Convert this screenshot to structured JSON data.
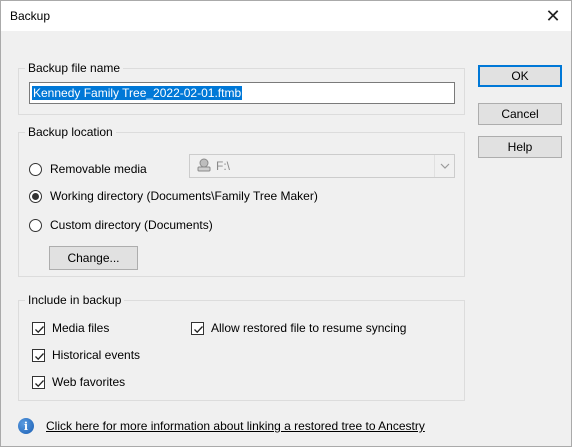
{
  "window": {
    "title": "Backup",
    "close_symbol": "✕"
  },
  "filename_group": {
    "label": "Backup file name",
    "value": "Kennedy Family Tree_2022-02-01.ftmb"
  },
  "buttons": {
    "ok": "OK",
    "cancel": "Cancel",
    "help": "Help"
  },
  "location_group": {
    "label": "Backup location",
    "options": [
      {
        "label": "Removable media",
        "selected": false
      },
      {
        "label": "Working directory (Documents\\Family Tree Maker)",
        "selected": true
      },
      {
        "label": "Custom directory (Documents)",
        "selected": false
      }
    ],
    "drive_value": "F:\\",
    "change_label": "Change..."
  },
  "include_group": {
    "label": "Include in backup",
    "items": [
      {
        "label": "Media files",
        "checked": true
      },
      {
        "label": "Historical events",
        "checked": true
      },
      {
        "label": "Web favorites",
        "checked": true
      },
      {
        "label": "Allow restored file to resume syncing",
        "checked": true
      }
    ]
  },
  "info": {
    "icon": "info-icon",
    "link_text": "Click here for more information about linking a restored tree to Ancestry"
  },
  "colors": {
    "accent": "#0078d7",
    "dialog_bg": "#f0f0f0"
  }
}
